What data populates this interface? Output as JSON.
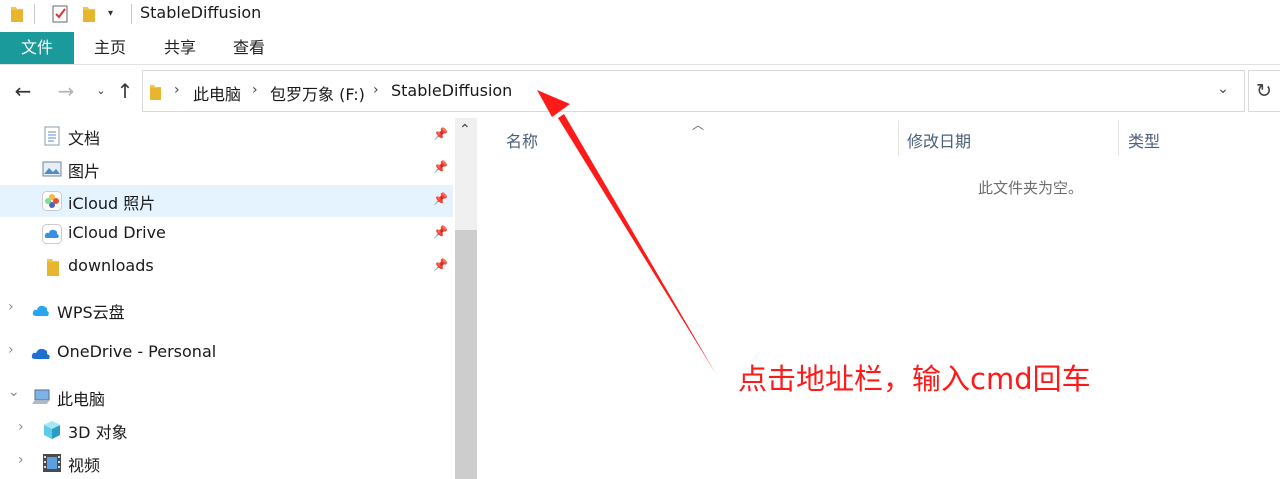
{
  "window": {
    "title": "StableDiffusion"
  },
  "ribbon": {
    "tabs": [
      {
        "label": "文件"
      },
      {
        "label": "主页"
      },
      {
        "label": "共享"
      },
      {
        "label": "查看"
      }
    ]
  },
  "address": {
    "crumbs": [
      "此电脑",
      "包罗万象 (F:)",
      "StableDiffusion"
    ]
  },
  "sidebar": {
    "quick_access": [
      {
        "label": "文档",
        "icon": "document-icon"
      },
      {
        "label": "图片",
        "icon": "pictures-icon"
      },
      {
        "label": "iCloud 照片",
        "icon": "icloud-photos-icon",
        "selected": true
      },
      {
        "label": "iCloud Drive",
        "icon": "icloud-drive-icon"
      },
      {
        "label": "downloads",
        "icon": "folder-icon"
      }
    ],
    "roots": [
      {
        "label": "WPS云盘",
        "icon": "wps-cloud-icon"
      },
      {
        "label": "OneDrive - Personal",
        "icon": "onedrive-icon"
      },
      {
        "label": "此电脑",
        "icon": "this-pc-icon"
      }
    ],
    "pc_children": [
      {
        "label": "3D 对象",
        "icon": "3d-objects-icon"
      },
      {
        "label": "视频",
        "icon": "videos-icon"
      }
    ]
  },
  "content": {
    "columns": [
      "名称",
      "修改日期",
      "类型"
    ],
    "empty_message": "此文件夹为空。"
  },
  "annotation": {
    "text": "点击地址栏，输入cmd回车",
    "color": "#ff1a1a"
  },
  "colors": {
    "file_tab": "#1b9a9c",
    "selected_row": "#e5f3ff",
    "header_text": "#4c607a"
  }
}
